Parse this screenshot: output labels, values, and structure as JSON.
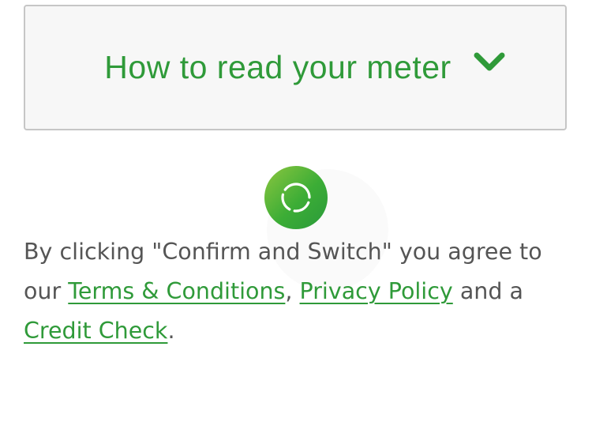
{
  "accordion": {
    "title": "How to read your meter",
    "icon": "chevron-down-icon",
    "expanded": false
  },
  "loader": {
    "icon": "loading-spinner-icon"
  },
  "consent": {
    "text_before": "By clicking \"Confirm and Switch\" you agree to our ",
    "terms_link": "Terms & Conditions",
    "separator": ",",
    "privacy_link": "Privacy Policy",
    "text_middle": " and a ",
    "credit_link": "Credit Check",
    "text_after": "."
  },
  "colors": {
    "accent_green": "#2f9a39",
    "spinner_light": "#8cc63f",
    "spinner_dark": "#2a9a3b",
    "body_text": "#555555",
    "box_border": "#c6c6c6",
    "box_background": "#f7f7f7"
  }
}
